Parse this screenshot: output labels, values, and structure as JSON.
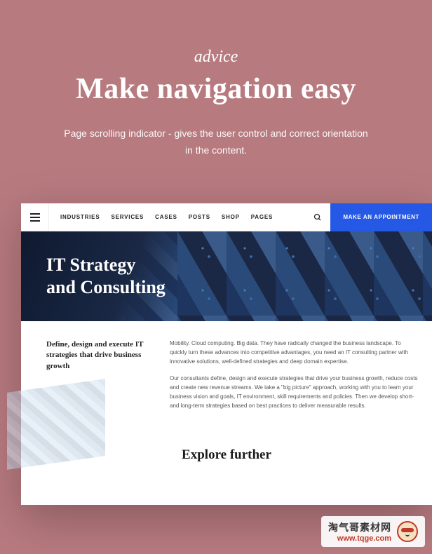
{
  "hero": {
    "eyebrow": "advice",
    "headline": "Make navigation easy",
    "subhead": "Page scrolling indicator - gives the user control and correct orientation in the content."
  },
  "nav": {
    "items": [
      "INDUSTRIES",
      "SERVICES",
      "CASES",
      "POSTS",
      "SHOP",
      "PAGES"
    ],
    "cta": "MAKE AN APPOINTMENT"
  },
  "banner": {
    "title_l1": "IT Strategy",
    "title_l2": "and Consulting"
  },
  "content": {
    "left_heading": "Define, design and execute IT strategies that drive business growth",
    "para1": "Mobility. Cloud computing. Big data. They have radically changed the business landscape. To quickly turn these advances into competitive advantages, you need an IT consulting partner with innovative solutions, well-defined strategies and deep domain expertise.",
    "para2": "Our consultants define, design and execute strategies that drive your business growth, reduce costs and create new revenue streams. We take a \"big picture\" approach, working with you to learn your business vision and goals, IT environment, skill requirements and policies. Then we develop short- and long-term strategies based on best practices to deliver measurable results."
  },
  "explore": {
    "title": "Explore further"
  },
  "watermark": {
    "cn": "淘气哥素材网",
    "url": "www.tqge.com"
  }
}
